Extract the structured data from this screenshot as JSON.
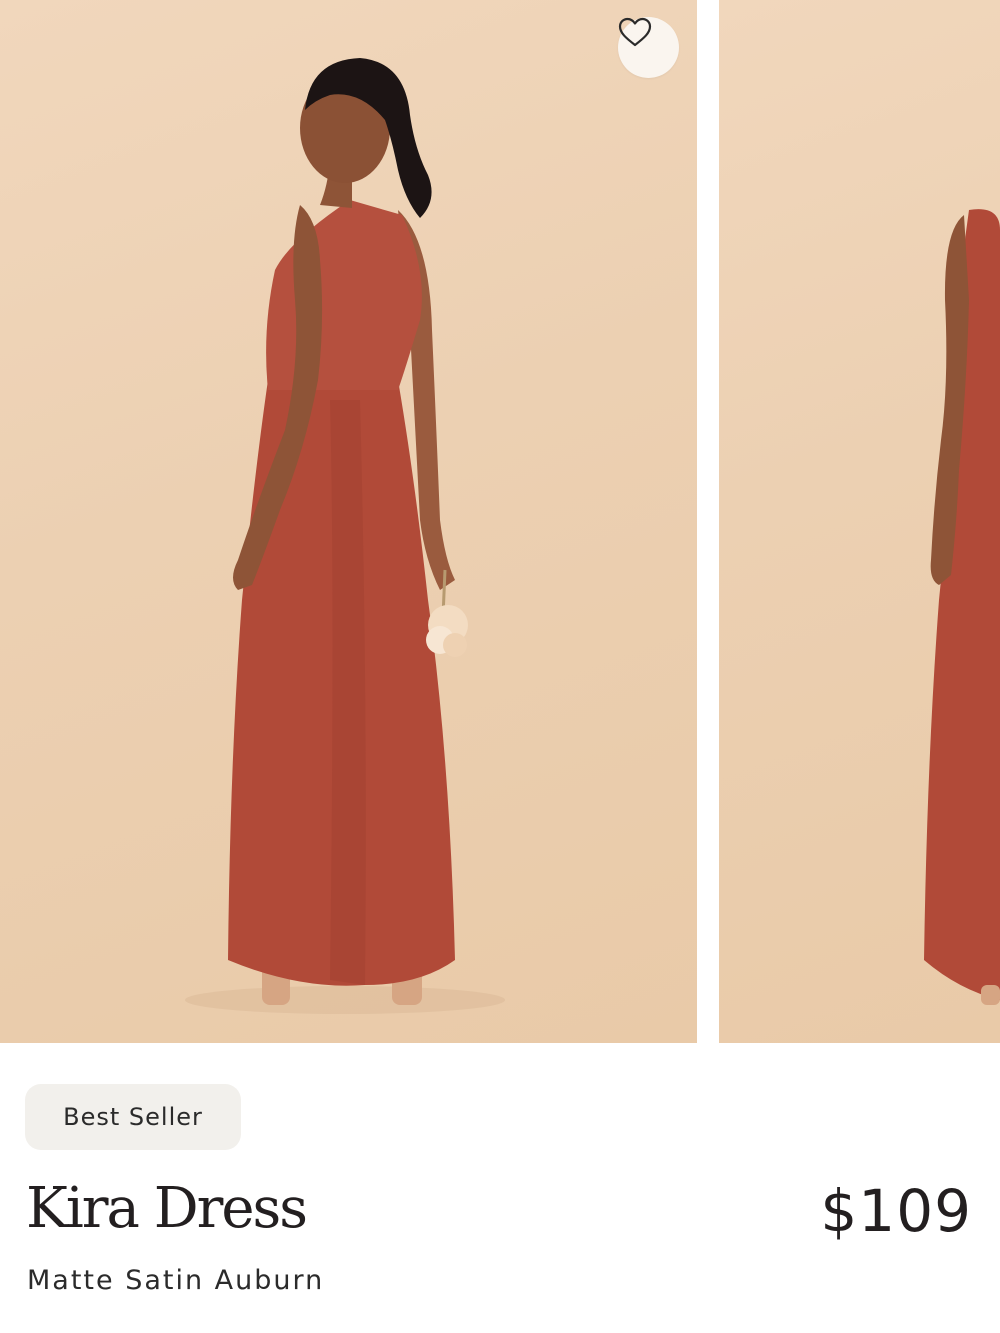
{
  "product": {
    "badge": "Best Seller",
    "name": "Kira Dress",
    "variant": "Matte Satin Auburn",
    "price": "$109"
  },
  "gallery": {
    "favorite_icon": "heart-outline-icon",
    "images": [
      {
        "subject": "model in one-shoulder auburn maxi dress, back view, holding bouquet"
      },
      {
        "subject": "model in auburn dress, side view (partially visible)"
      }
    ]
  },
  "colors": {
    "dress": "#b14a38",
    "backdrop": "#ecd0b2",
    "text": "#231f20",
    "badge_bg": "#f2f0ec"
  }
}
